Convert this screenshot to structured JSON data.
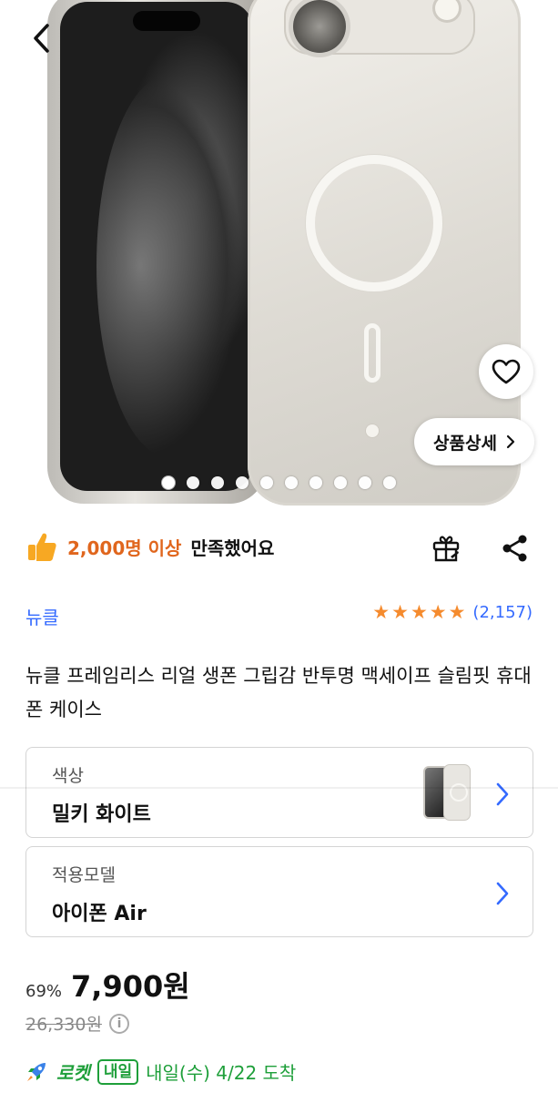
{
  "hero": {
    "image_count": 10,
    "active_index": 0,
    "detail_button_label": "상품상세"
  },
  "satisfaction": {
    "count_text": "2,000명 이상",
    "suffix_text": "만족했어요"
  },
  "brand": "뉴클",
  "rating": {
    "stars": 5,
    "review_count": "(2,157)"
  },
  "product_title": "뉴클 프레임리스 리얼 생폰 그립감 반투명 맥세이프 슬림핏 휴대폰 케이스",
  "options": [
    {
      "label": "색상",
      "value": "밀키 화이트"
    },
    {
      "label": "적용모델",
      "value": "아이폰 Air"
    }
  ],
  "price": {
    "discount": "69%",
    "sale_price": "7,900원",
    "original_price": "26,330원"
  },
  "delivery": {
    "rocket_label": "로켓",
    "badge": "내일",
    "date_text": "내일(수) 4/22 도착"
  },
  "colors": {
    "accent_blue": "#346aff",
    "satisfaction_orange": "#e0661d",
    "star_orange": "#f58b2e",
    "rocket_green": "#1e9f3a"
  },
  "icons": [
    "back-arrow-icon",
    "heart-icon",
    "chevron-right-icon",
    "thumbs-up-icon",
    "gift-icon",
    "share-icon",
    "star-icon",
    "info-icon",
    "rocket-icon"
  ]
}
